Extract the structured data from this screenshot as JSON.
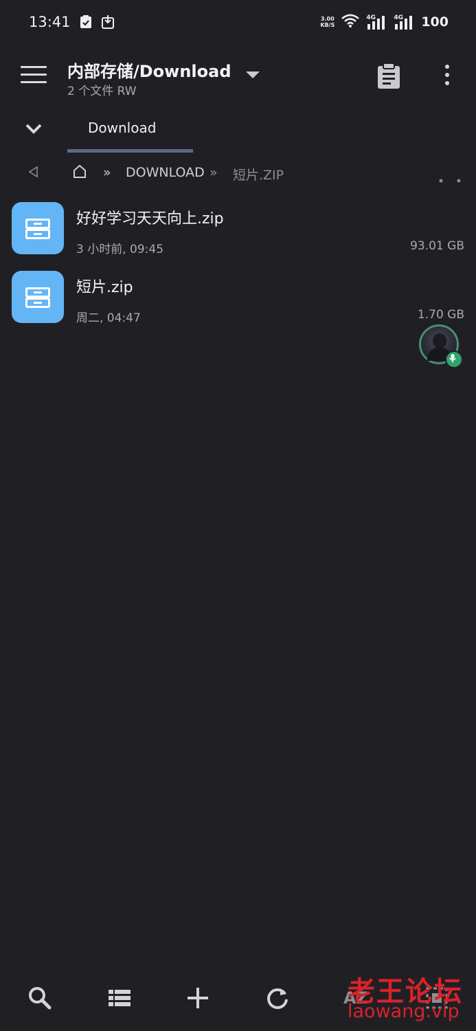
{
  "status_bar": {
    "time": "13:41",
    "net_speed_value": "3.00",
    "net_speed_unit": "KB/S",
    "signal1_label": "4G",
    "signal2_label": "4G",
    "battery": "100"
  },
  "toolbar": {
    "title": "内部存储/Download",
    "subtitle": "2 个文件 RW"
  },
  "tabs": [
    {
      "label": "Download",
      "active": true
    }
  ],
  "breadcrumb": {
    "separator": "»",
    "segments": [
      "DOWNLOAD",
      "短片.ZIP"
    ]
  },
  "files": [
    {
      "name": "好好学习天天向上.zip",
      "modified": "3 小时前, 09:45",
      "size": "93.01 GB"
    },
    {
      "name": "短片.zip",
      "modified": "周二, 04:47",
      "size": "1.70 GB"
    }
  ],
  "bottom_bar": {
    "sort_label": "AZ"
  },
  "watermark": {
    "chinese": "老王论坛",
    "url": "laowang.vip"
  },
  "colors": {
    "background": "#202024",
    "file_icon": "#64b5f6",
    "tab_indicator": "#5b6a8a",
    "watermark": "#d9222a",
    "mic_badge": "#2fa56d"
  }
}
